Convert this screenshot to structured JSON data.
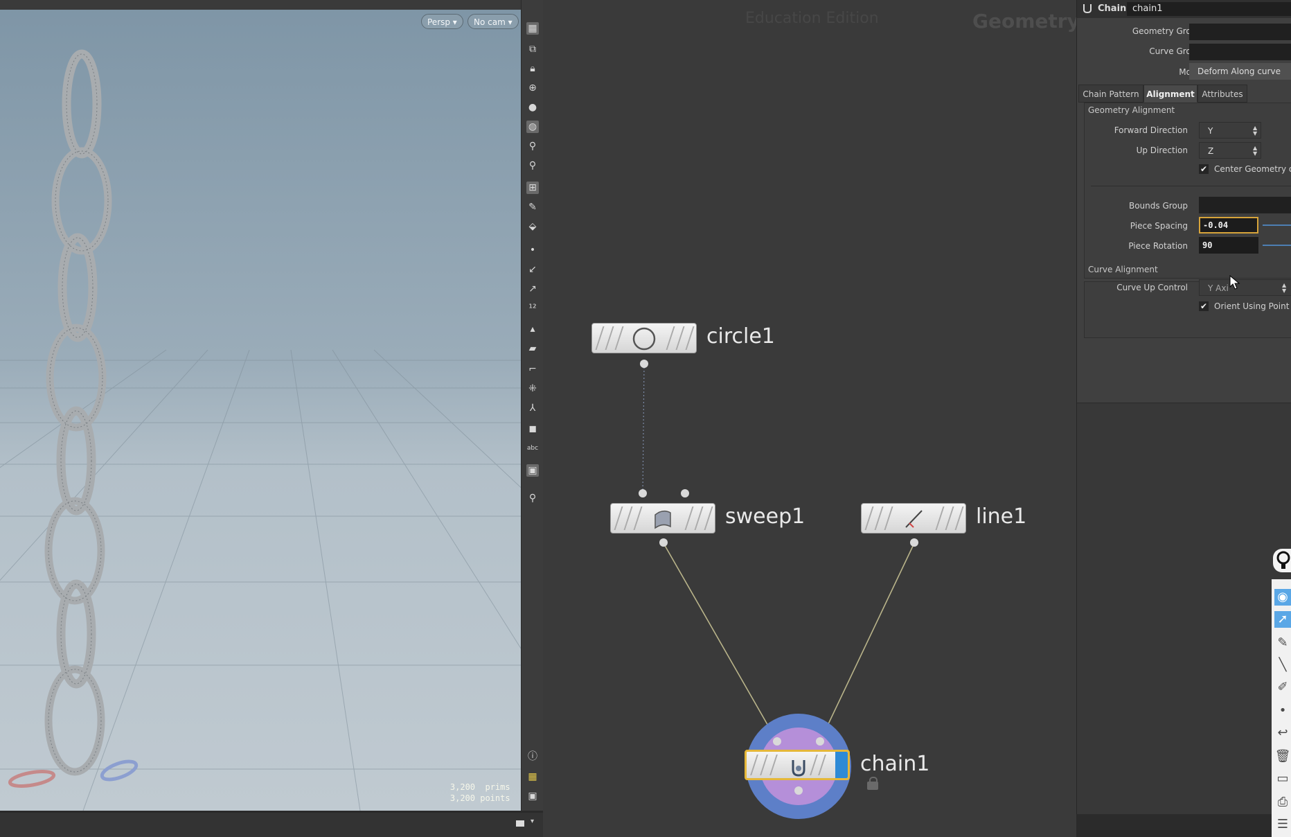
{
  "viewport": {
    "persp_label": "Persp ▾",
    "cam_label": "No cam ▾",
    "stats": [
      {
        "value": "3,200",
        "unit": "prims"
      },
      {
        "value": "3,200",
        "unit": "points"
      }
    ]
  },
  "network": {
    "watermark_edition": "Education Edition",
    "watermark_context": "Geometry",
    "nodes": {
      "circle": "circle1",
      "sweep": "sweep1",
      "line": "line1",
      "chain": "chain1"
    }
  },
  "params": {
    "node_type": "Chain",
    "node_name": "chain1",
    "geometry_group_label": "Geometry Group",
    "curve_group_label": "Curve Group",
    "mode_label": "Mode",
    "mode_value": "Deform Along curve",
    "tabs": [
      "Chain Pattern",
      "Alignment",
      "Attributes"
    ],
    "active_tab": "Alignment",
    "geometry_alignment": {
      "title": "Geometry Alignment",
      "forward_direction_label": "Forward Direction",
      "forward_direction_value": "Y",
      "up_direction_label": "Up Direction",
      "up_direction_value": "Z",
      "center_geometry_label": "Center Geometry o",
      "center_geometry_checked": true,
      "bounds_group_label": "Bounds Group",
      "piece_spacing_label": "Piece Spacing",
      "piece_spacing_value": "-0.04",
      "piece_rotation_label": "Piece Rotation",
      "piece_rotation_value": "90"
    },
    "curve_alignment": {
      "title": "Curve Alignment",
      "curve_up_control_label": "Curve Up Control",
      "curve_up_control_value": "Y Axi",
      "orient_label": "Orient Using Point A",
      "orient_checked": true
    }
  },
  "colors": {
    "wire": "#b9b48a",
    "selected_node_outline": "#e5b739",
    "chain_blue_flag": "#2e8ad6",
    "display_flag_circle": "#5d7fc8"
  }
}
